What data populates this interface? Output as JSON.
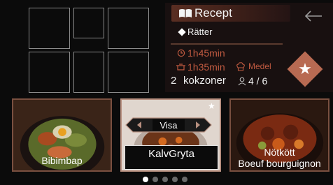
{
  "header": {
    "title": "Recept",
    "subtitle": "Rätter"
  },
  "recipe_info": {
    "cook_time": "1h45min",
    "prep_time": "1h35min",
    "difficulty": "Medel",
    "zones_count": "2",
    "zones_label": "kokzoner",
    "servings": "4 / 6"
  },
  "cards": [
    {
      "label": "Bibimbap"
    },
    {
      "label": "KalvGryta",
      "action": "Visa"
    },
    {
      "label_line1": "Nötkött",
      "label_line2": "Boeuf bourguignon"
    }
  ],
  "pagination": {
    "pages": 5,
    "active": 1
  },
  "colors": {
    "accent": "#b86a52",
    "info": "#c05a40",
    "panel": "#181010"
  },
  "icons": [
    "book-icon",
    "back-arrow-icon",
    "favorite-star-icon",
    "timer-icon",
    "pot-icon",
    "chef-hat-icon",
    "person-icon"
  ]
}
